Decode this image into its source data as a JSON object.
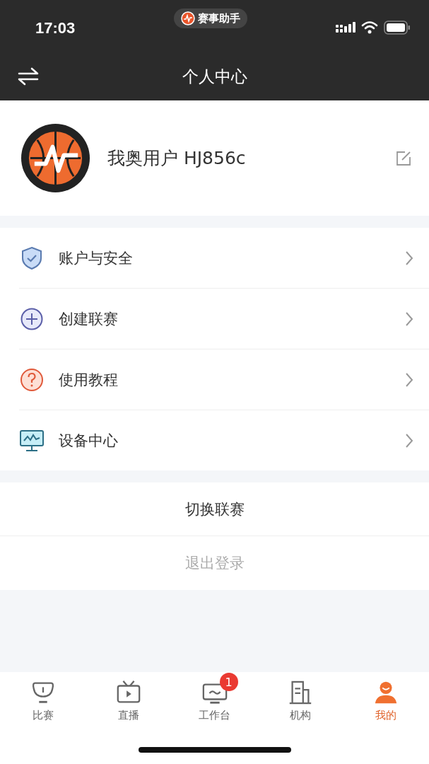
{
  "status_bar": {
    "time": "17:03",
    "app_pill": "赛事助手"
  },
  "nav": {
    "title": "个人中心"
  },
  "profile": {
    "name": "我奥用户 HJ856c"
  },
  "menu": [
    {
      "kind": "shield",
      "label": "账户与安全"
    },
    {
      "kind": "plus",
      "label": "创建联赛"
    },
    {
      "kind": "question",
      "label": "使用教程"
    },
    {
      "kind": "monitor",
      "label": "设备中心"
    }
  ],
  "actions": [
    {
      "label": "切换联赛",
      "disabled": false
    },
    {
      "label": "退出登录",
      "disabled": true
    }
  ],
  "tabs": [
    {
      "kind": "trophy",
      "label": "比赛",
      "selected": false
    },
    {
      "kind": "tv",
      "label": "直播",
      "selected": false
    },
    {
      "kind": "desk",
      "label": "工作台",
      "selected": false,
      "badge": "1"
    },
    {
      "kind": "building",
      "label": "机构",
      "selected": false
    },
    {
      "kind": "person",
      "label": "我的",
      "selected": true
    }
  ]
}
